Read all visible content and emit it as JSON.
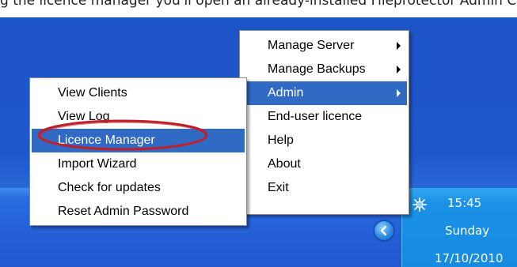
{
  "caption": {
    "text": "g the licence manager you'll open an already-installed Fileprotector Admin Console, and ev"
  },
  "main_menu": {
    "items": [
      {
        "label": "Manage Server",
        "has_submenu": true,
        "selected": false
      },
      {
        "label": "Manage Backups",
        "has_submenu": true,
        "selected": false
      },
      {
        "label": "Admin",
        "has_submenu": true,
        "selected": true
      },
      {
        "label": "End-user licence",
        "has_submenu": false,
        "selected": false
      },
      {
        "label": "Help",
        "has_submenu": false,
        "selected": false
      },
      {
        "label": "About",
        "has_submenu": false,
        "selected": false
      },
      {
        "label": "Exit",
        "has_submenu": false,
        "selected": false
      }
    ]
  },
  "admin_submenu": {
    "items": [
      {
        "label": "View Clients",
        "selected": false
      },
      {
        "label": "View Log",
        "selected": false
      },
      {
        "label": "Licence Manager",
        "selected": true
      },
      {
        "label": "Import Wizard",
        "selected": false
      },
      {
        "label": "Check for updates",
        "selected": false
      },
      {
        "label": "Reset Admin Password",
        "selected": false
      }
    ]
  },
  "tray": {
    "time": "15:45",
    "day": "Sunday",
    "date": "17/10/2010",
    "icons": [
      "app-tray-icon",
      "show-hidden-icons-chevron"
    ]
  },
  "annotation": {
    "color": "#c0202a"
  },
  "colors": {
    "selection": "#316ac5",
    "desktop": "#1f58cc",
    "tray": "#168be2"
  }
}
